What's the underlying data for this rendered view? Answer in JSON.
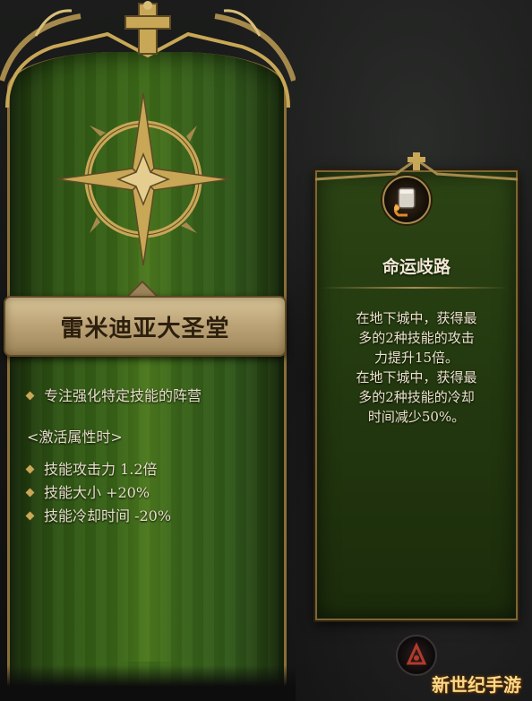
{
  "left_banner": {
    "title": "雷米迪亚大圣堂",
    "description": "专注强化特定技能的阵营",
    "section_header": "<激活属性时>",
    "stats": [
      "技能攻击力 1.2倍",
      "技能大小 +20%",
      "技能冷却时间 -20%"
    ],
    "emblem_icon": "compass-star-icon",
    "cloth_color": "#3e6c19",
    "trim_color": "#c8a756"
  },
  "skill_card": {
    "title": "命运歧路",
    "body_lines": [
      "在地下城中，获得最",
      "多的2种技能的攻击",
      "力提升15倍。",
      "在地下城中，获得最",
      "多的2种技能的冷却",
      "时间减少50%。"
    ],
    "icon": "armored-fist-icon",
    "card_color": "#243a10"
  },
  "controls": {
    "round_button_icon": "rune-icon"
  },
  "watermark": {
    "text": "新世纪手游"
  }
}
